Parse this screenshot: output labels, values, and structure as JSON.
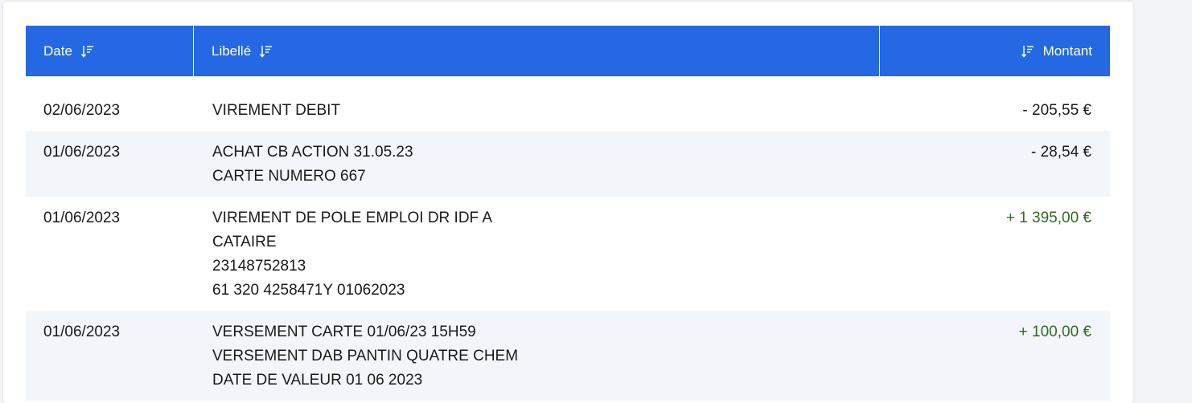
{
  "header": {
    "date_label": "Date",
    "libelle_label": "Libellé",
    "montant_label": "Montant"
  },
  "colors": {
    "header_bg": "#2469e3",
    "credit": "#2e6b1f",
    "row_alt": "#f2f5fa"
  },
  "rows": [
    {
      "date": "02/06/2023",
      "lines": [
        "VIREMENT DEBIT"
      ],
      "amount": "- 205,55 €",
      "type": "debit"
    },
    {
      "date": "01/06/2023",
      "lines": [
        "ACHAT CB ACTION 31.05.23",
        "CARTE NUMERO 667"
      ],
      "amount": "- 28,54 €",
      "type": "debit"
    },
    {
      "date": "01/06/2023",
      "lines": [
        "VIREMENT DE POLE EMPLOI DR IDF A",
        "CATAIRE",
        "23148752813",
        "61 320 4258471Y 01062023"
      ],
      "amount": "+ 1 395,00 €",
      "type": "credit"
    },
    {
      "date": "01/06/2023",
      "lines": [
        "VERSEMENT CARTE 01/06/23 15H59",
        "VERSEMENT DAB PANTIN QUATRE CHEM",
        "DATE DE VALEUR 01 06 2023"
      ],
      "amount": "+ 100,00 €",
      "type": "credit"
    }
  ]
}
